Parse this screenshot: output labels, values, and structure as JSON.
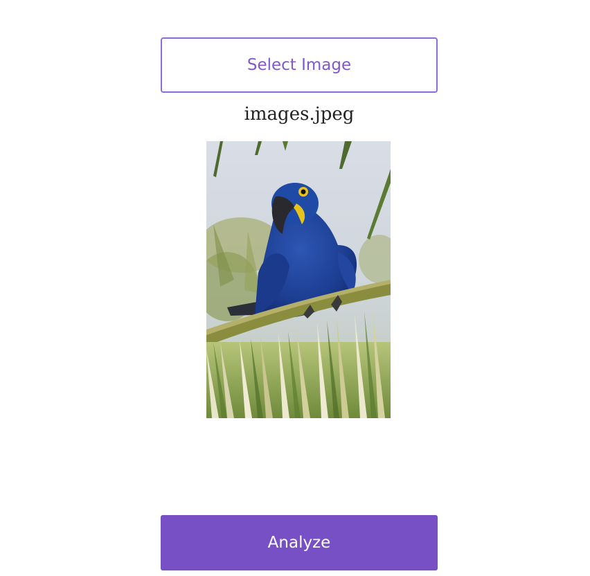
{
  "select_button": {
    "label": "Select Image"
  },
  "selected_file": {
    "name": "images.jpeg"
  },
  "preview": {
    "icon": "macaw-photo"
  },
  "analyze_button": {
    "label": "Analyze"
  },
  "colors": {
    "accent": "#7850c6",
    "accent_text": "#8159cc"
  }
}
